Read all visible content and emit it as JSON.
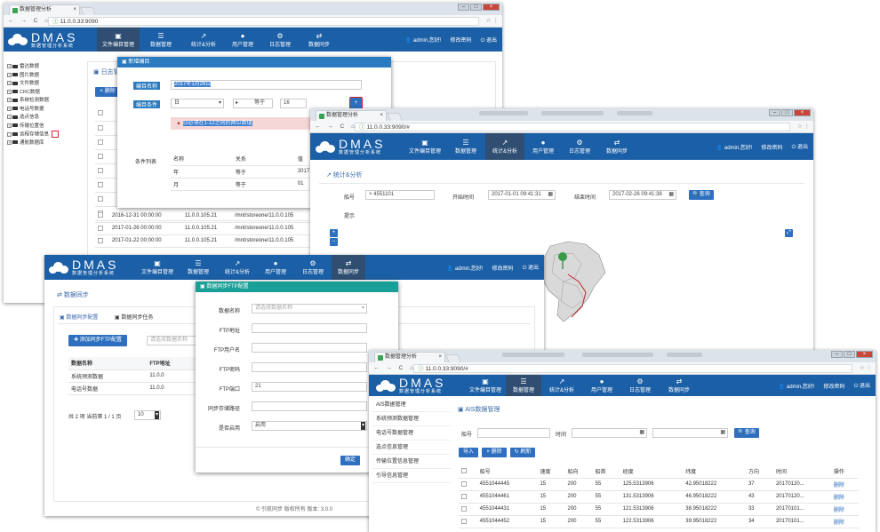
{
  "tab_title": "数据管理分析",
  "app": {
    "name": "DMAS",
    "subtitle": "数据管理分析系统"
  },
  "header_right": {
    "user": "admin,您好!",
    "change_pwd": "修改密码",
    "logout": "退出"
  },
  "menu": [
    {
      "label": "文件编目管理",
      "icon": "file-icon"
    },
    {
      "label": "数据管理",
      "icon": "database-icon"
    },
    {
      "label": "统计&分析",
      "icon": "chart-icon"
    },
    {
      "label": "用户管理",
      "icon": "user-icon"
    },
    {
      "label": "日志管理",
      "icon": "gears-icon"
    },
    {
      "label": "数据同步",
      "icon": "sync-icon"
    }
  ],
  "win1": {
    "url": "11.0.0.33:9090",
    "tree": [
      {
        "t": "+",
        "label": "雷达数据"
      },
      {
        "t": "+",
        "label": "图片数据"
      },
      {
        "t": "+",
        "label": "文件数据"
      },
      {
        "t": "+",
        "label": "CRC数据"
      },
      {
        "t": "+",
        "label": "系统检测数据"
      },
      {
        "t": "+",
        "label": "电话号数据"
      },
      {
        "t": "+",
        "label": "选点信息"
      },
      {
        "t": "+",
        "label": "传输位置信"
      },
      {
        "t": "-",
        "label": "远程存储信息"
      },
      {
        "t": "+",
        "label": "通航数据库"
      }
    ],
    "page_title": "日志管理",
    "delete_label": "删除",
    "rows": [
      {
        "time": "2016-12-31 00:00:00",
        "ip": "11.0.0.105.21",
        "path": "/mnt/storeone/11.0.0.105"
      },
      {
        "time": "2017-01-26 00:00:00",
        "ip": "11.0.0.105.21",
        "path": "/mnt/storeone/11.0.0.105"
      },
      {
        "time": "2017-01-22 00:00:00",
        "ip": "11.0.0.105.21",
        "path": "/mnt/storeone/11.0.0.105"
      }
    ],
    "modal": {
      "title": "新增编目",
      "name_label": "编目名称",
      "name_value": "2017年1月26日",
      "cond_label": "编目条件",
      "cond_field": "日",
      "cond_op": "等于",
      "cond_value": "16",
      "add_btn": "+",
      "alert": "日必须在1-12之间的两位数值",
      "list_label": "条件列表",
      "list_cols": [
        "名称",
        "关系",
        "值"
      ],
      "list_rows": [
        {
          "name": "年",
          "rel": "等于",
          "val": "2017"
        },
        {
          "name": "月",
          "rel": "等于",
          "val": "01"
        }
      ]
    }
  },
  "win2": {
    "url": "11.0.0.33:9090/#",
    "page_title": "统计&分析",
    "ship_label": "船号",
    "ship_value": "× 4551101",
    "start_label": "开始时间",
    "start_value": "2017-01-01 09:41:31",
    "end_label": "结束时间",
    "end_value": "2017-02-26 09:41:38",
    "query_btn": "查询",
    "hint_label": "提示"
  },
  "win3": {
    "page_title": "数据同步",
    "tabs": [
      "数据同步配置",
      "数据同步任务"
    ],
    "add_btn": "添加同步FTP配置",
    "search_placeholder": "请选择数据名称",
    "cols": [
      "数据名称",
      "FTP地址"
    ],
    "rows": [
      {
        "name": "系统预测数据",
        "ftp": "11.0.0"
      },
      {
        "name": "电话号数据",
        "ftp": "11.0.0"
      }
    ],
    "pager": "共 2 项 当前第 1 / 1 页",
    "page_size": "10",
    "footer": "© 引航同步 版权所有 版本: 3.0.0",
    "modal": {
      "title": "数据同步FTP配置",
      "fields": [
        {
          "label": "数据名称",
          "value": "请选择数据名称"
        },
        {
          "label": "FTP地址",
          "value": ""
        },
        {
          "label": "FTP用户名",
          "value": ""
        },
        {
          "label": "FTP密码",
          "value": ""
        },
        {
          "label": "FTP端口",
          "value": "21"
        },
        {
          "label": "同步存储路径",
          "value": ""
        },
        {
          "label": "是否启用",
          "value": "启用"
        }
      ],
      "ok_btn": "确定"
    }
  },
  "win4": {
    "url": "11.0.0.33:9090/#",
    "sidebar": [
      "AIS数据管理",
      "系统预测数据管理",
      "电话号数据管理",
      "选点信息管理",
      "传输位置信息管理",
      "引导信息管理"
    ],
    "page_title": "AIS数据管理",
    "ship_label": "船号",
    "time_label": "时间",
    "query_btn": "查询",
    "import_btn": "导入",
    "delete_btn": "删除",
    "refresh_btn": "刷新",
    "cols": [
      "船号",
      "速度",
      "船向",
      "船首",
      "经度",
      "纬度",
      "方向",
      "时间",
      "操作"
    ],
    "rows": [
      {
        "ship": "4551044445",
        "speed": "15",
        "course": "200",
        "head": "55",
        "lng": "125.5313906",
        "lat": "42.95018222",
        "dir": "37",
        "time": "20170120...",
        "op": "删除"
      },
      {
        "ship": "4551044461",
        "speed": "15",
        "course": "200",
        "head": "55",
        "lng": "131.5313906",
        "lat": "46.95018222",
        "dir": "43",
        "time": "20170120...",
        "op": "删除"
      },
      {
        "ship": "4551044431",
        "speed": "15",
        "course": "200",
        "head": "55",
        "lng": "121.5313906",
        "lat": "38.95018222",
        "dir": "33",
        "time": "20170101...",
        "op": "删除"
      },
      {
        "ship": "4551044452",
        "speed": "15",
        "course": "200",
        "head": "55",
        "lng": "122.5313906",
        "lat": "39.95018222",
        "dir": "34",
        "time": "20170101...",
        "op": "删除"
      }
    ]
  }
}
